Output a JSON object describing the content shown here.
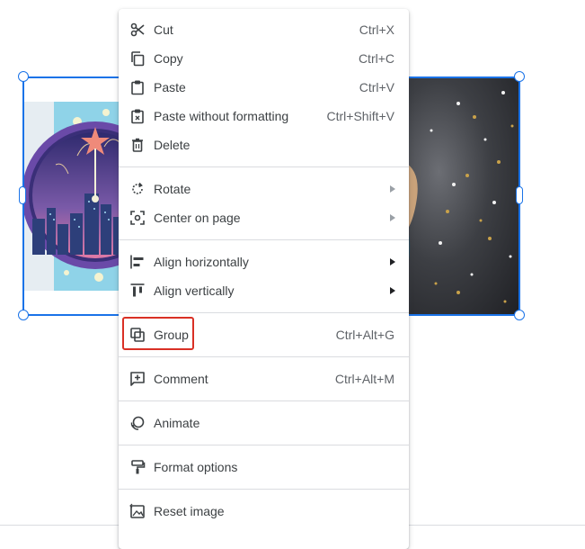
{
  "colors": {
    "selection": "#1a73e8",
    "highlight": "#d93025",
    "text": "#3c4043",
    "shortcut": "#5f6368"
  },
  "context_menu": {
    "sections": [
      [
        {
          "label": "Cut",
          "shortcut": "Ctrl+X",
          "icon": "scissors-icon"
        },
        {
          "label": "Copy",
          "shortcut": "Ctrl+C",
          "icon": "copy-icon"
        },
        {
          "label": "Paste",
          "shortcut": "Ctrl+V",
          "icon": "clipboard-icon"
        },
        {
          "label": "Paste without formatting",
          "shortcut": "Ctrl+Shift+V",
          "icon": "paste-plain-icon"
        },
        {
          "label": "Delete",
          "shortcut": "",
          "icon": "trash-icon"
        }
      ],
      [
        {
          "label": "Rotate",
          "submenu": true,
          "icon": "rotate-icon"
        },
        {
          "label": "Center on page",
          "submenu": true,
          "icon": "center-icon"
        }
      ],
      [
        {
          "label": "Align horizontally",
          "submenu": true,
          "icon": "align-horizontal-icon"
        },
        {
          "label": "Align vertically",
          "submenu": true,
          "icon": "align-vertical-icon"
        }
      ],
      [
        {
          "label": "Group",
          "shortcut": "Ctrl+Alt+G",
          "icon": "group-icon",
          "highlighted": true
        }
      ],
      [
        {
          "label": "Comment",
          "shortcut": "Ctrl+Alt+M",
          "icon": "comment-add-icon"
        }
      ],
      [
        {
          "label": "Animate",
          "icon": "animate-icon"
        }
      ],
      [
        {
          "label": "Format options",
          "icon": "format-paint-icon"
        }
      ],
      [
        {
          "label": "Reset image",
          "icon": "reset-image-icon"
        }
      ]
    ]
  }
}
